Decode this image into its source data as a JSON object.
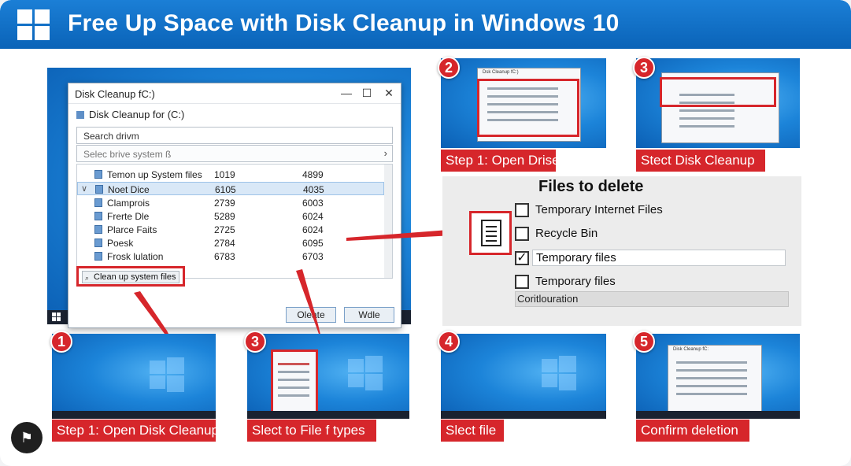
{
  "header": {
    "title": "Free Up Space with Disk Cleanup in Windows 10"
  },
  "dialog": {
    "title": "Disk Cleanup fC:)",
    "subtitle": "Disk Cleanup for (C:)",
    "search_text": "Search drivm",
    "select_placeholder": "Selec brive system ß",
    "rows": [
      {
        "name": "Temon up System files",
        "v1": "1019",
        "v2": "4899"
      },
      {
        "name": "Noet Dice",
        "v1": "6105",
        "v2": "4035"
      },
      {
        "name": "Clamprois",
        "v1": "2739",
        "v2": "6003"
      },
      {
        "name": "Frerte Dle",
        "v1": "5289",
        "v2": "6024"
      },
      {
        "name": "Plarce Faits",
        "v1": "2725",
        "v2": "6024"
      },
      {
        "name": "Poesk",
        "v1": "2784",
        "v2": "6095"
      },
      {
        "name": "Frosk lulation",
        "v1": "6783",
        "v2": "6703"
      }
    ],
    "clean_button": "Clean up system files",
    "ok_button": "Oleate",
    "cancel_button": "Wdle"
  },
  "files_panel": {
    "title": "Files to delete",
    "items": [
      {
        "label": "Temporary Internet Files",
        "checked": ""
      },
      {
        "label": "Recycle Bin",
        "checked": ""
      },
      {
        "label": "Temporary files",
        "checked": "✓"
      },
      {
        "label": "Temporary files",
        "checked": ""
      }
    ],
    "cert_bar": "Coritlouration"
  },
  "steps": {
    "top1": {
      "badge": "2",
      "caption": "Step 1: Open Drise",
      "win_title": "Dsk Cleanup fC:)"
    },
    "top2": {
      "badge": "3",
      "caption": "Stect Disk Cleanup"
    },
    "b1": {
      "badge": "1",
      "caption": "Step 1: Open Disk Cleanup"
    },
    "b2": {
      "badge": "3",
      "caption": "Slect to File f types"
    },
    "b3": {
      "badge": "4",
      "caption": "Slect file"
    },
    "b4": {
      "badge": "5",
      "caption": "Confirm deletion",
      "win_title": "Disk Cleanup fC:"
    }
  },
  "colors": {
    "accent_red": "#d6262b",
    "header_blue": "#0a63b8"
  }
}
